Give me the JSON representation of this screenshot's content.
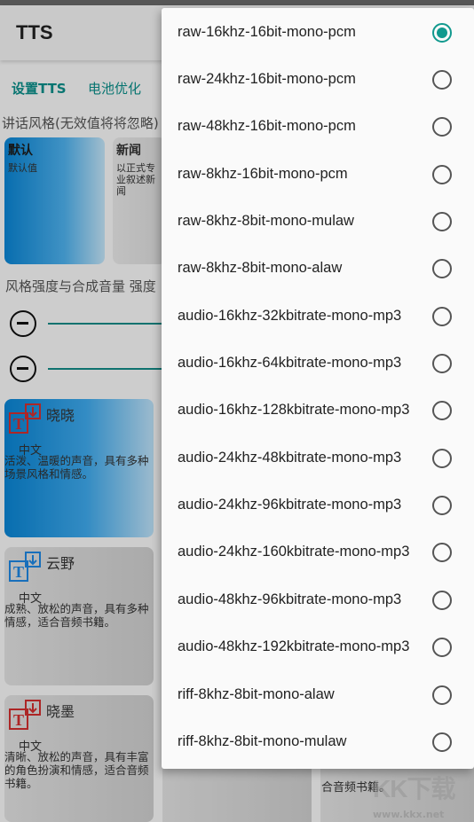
{
  "app": {
    "title": "TTS"
  },
  "tabs": [
    {
      "label": "设置TTS"
    },
    {
      "label": "电池优化"
    }
  ],
  "style_section": {
    "label": "讲话风格(无效值将将忽略)",
    "cards": [
      {
        "name": "默认",
        "desc": "默认值",
        "selected": true
      },
      {
        "name": "新闻",
        "desc": "以正式专业叙述新闻",
        "selected": false
      }
    ]
  },
  "strength_section": {
    "label": "风格强度与合成音量  强度"
  },
  "voices": [
    {
      "name": "晓晓",
      "lang": "中文",
      "desc": "活泼、温暖的声音，具有多种场景风格和情感。",
      "selected": true
    },
    {
      "name": "云野",
      "lang": "中文",
      "desc": "成熟、放松的声音，具有多种情感，适合音频书籍。",
      "selected": false
    },
    {
      "name": "晓墨",
      "lang": "中文",
      "desc": "清晰、放松的声音，具有丰富的角色扮演和情感，适合音频书籍。",
      "selected": false
    }
  ],
  "background_fragment": {
    "text": "合音频书籍。"
  },
  "format_menu": {
    "options": [
      {
        "label": "raw-16khz-16bit-mono-pcm",
        "checked": true
      },
      {
        "label": "raw-24khz-16bit-mono-pcm",
        "checked": false
      },
      {
        "label": "raw-48khz-16bit-mono-pcm",
        "checked": false
      },
      {
        "label": "raw-8khz-16bit-mono-pcm",
        "checked": false
      },
      {
        "label": "raw-8khz-8bit-mono-mulaw",
        "checked": false
      },
      {
        "label": "raw-8khz-8bit-mono-alaw",
        "checked": false
      },
      {
        "label": "audio-16khz-32kbitrate-mono-mp3",
        "checked": false
      },
      {
        "label": "audio-16khz-64kbitrate-mono-mp3",
        "checked": false
      },
      {
        "label": "audio-16khz-128kbitrate-mono-mp3",
        "checked": false
      },
      {
        "label": "audio-24khz-48kbitrate-mono-mp3",
        "checked": false
      },
      {
        "label": "audio-24khz-96kbitrate-mono-mp3",
        "checked": false
      },
      {
        "label": "audio-24khz-160kbitrate-mono-mp3",
        "checked": false
      },
      {
        "label": "audio-48khz-96kbitrate-mono-mp3",
        "checked": false
      },
      {
        "label": "audio-48khz-192kbitrate-mono-mp3",
        "checked": false
      },
      {
        "label": "riff-8khz-8bit-mono-alaw",
        "checked": false
      },
      {
        "label": "riff-8khz-8bit-mono-mulaw",
        "checked": false
      }
    ]
  },
  "watermark": {
    "big": "KK下载",
    "small": "www.kkx.net"
  },
  "colors": {
    "accent": "#0a8f8a",
    "radio_checked": "#11998e",
    "selected_card": "#0a86d6",
    "voice_icon_selected": "#d32f2f",
    "voice_icon_default": "#1e88e5"
  }
}
